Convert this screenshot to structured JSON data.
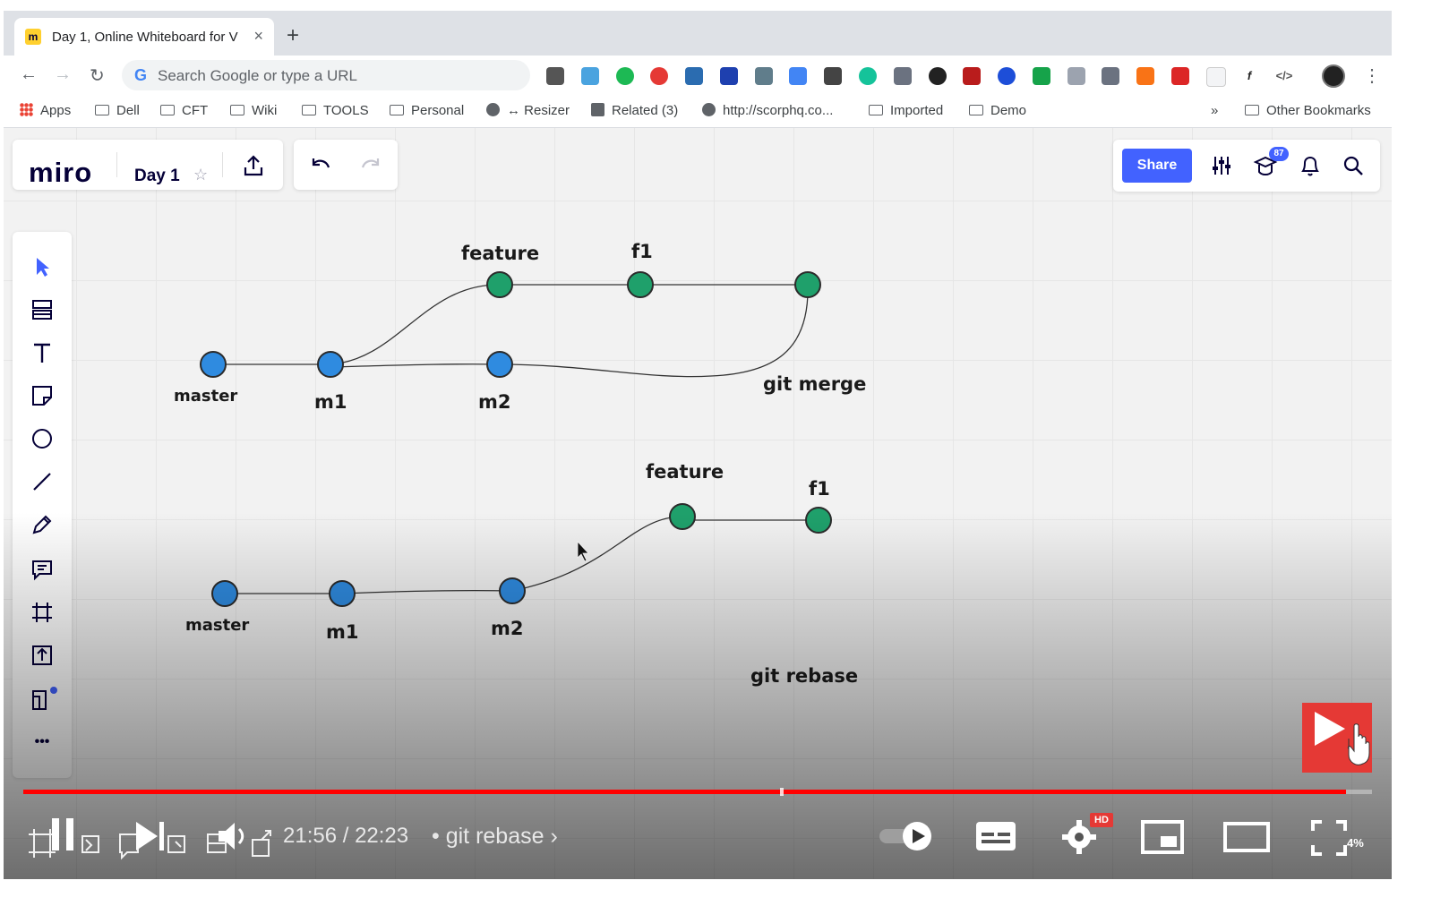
{
  "browser": {
    "tab_title": "Day 1, Online Whiteboard for V",
    "tab_favicon": "m",
    "new_tab": "+",
    "close": "×",
    "omnibox_placeholder": "Search Google or type a URL",
    "bookmarks": {
      "apps": "Apps",
      "dell": "Dell",
      "cft": "CFT",
      "wiki": "Wiki",
      "tools": "TOOLS",
      "personal": "Personal",
      "resizer": "↔ Resizer",
      "related": "Related (3)",
      "scorp": "http://scorphq.co...",
      "imported": "Imported",
      "demo": "Demo",
      "more": "»",
      "other": "Other Bookmarks"
    }
  },
  "miro": {
    "logo": "miro",
    "board_name": "Day 1",
    "share_label": "Share",
    "notification_count": "87",
    "more_tools": "•••"
  },
  "diagram": {
    "merge": {
      "caption": "git merge",
      "labels": {
        "feature": "feature",
        "f1": "f1",
        "master": "master",
        "m1": "m1",
        "m2": "m2"
      }
    },
    "rebase": {
      "caption": "git rebase",
      "labels": {
        "feature": "feature",
        "f1": "f1",
        "master": "master",
        "m1": "m1",
        "m2": "m2"
      }
    },
    "colors": {
      "master_node": "#2f8be0",
      "feature_node": "#1fa06b",
      "edge": "#333333"
    }
  },
  "player": {
    "time_current": "21:56",
    "time_total": "22:23",
    "timecode": "21:56 / 22:23",
    "separator": "•",
    "chapter": "git rebase",
    "progress": 0.981,
    "hd_badge": "HD",
    "zoom_text": "4%"
  }
}
